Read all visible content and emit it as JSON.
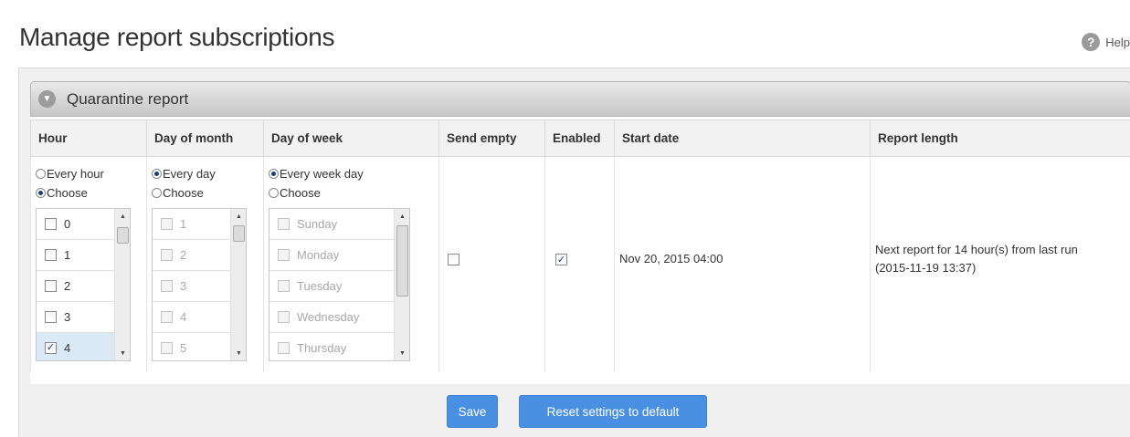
{
  "page": {
    "title": "Manage report subscriptions",
    "help_label": "Help"
  },
  "section": {
    "title": "Quarantine report"
  },
  "columns": [
    "Hour",
    "Day of month",
    "Day of week",
    "Send empty",
    "Enabled",
    "Start date",
    "Report length"
  ],
  "hour": {
    "options": [
      {
        "label": "Every hour",
        "checked": false
      },
      {
        "label": "Choose",
        "checked": true
      }
    ],
    "items": [
      {
        "label": "0",
        "checked": false
      },
      {
        "label": "1",
        "checked": false
      },
      {
        "label": "2",
        "checked": false
      },
      {
        "label": "3",
        "checked": false
      },
      {
        "label": "4",
        "checked": true
      }
    ]
  },
  "day_of_month": {
    "options": [
      {
        "label": "Every day",
        "checked": true
      },
      {
        "label": "Choose",
        "checked": false
      }
    ],
    "items": [
      {
        "label": "1"
      },
      {
        "label": "2"
      },
      {
        "label": "3"
      },
      {
        "label": "4"
      },
      {
        "label": "5"
      }
    ]
  },
  "day_of_week": {
    "options": [
      {
        "label": "Every week day",
        "checked": true
      },
      {
        "label": "Choose",
        "checked": false
      }
    ],
    "items": [
      {
        "label": "Sunday"
      },
      {
        "label": "Monday"
      },
      {
        "label": "Tuesday"
      },
      {
        "label": "Wednesday"
      },
      {
        "label": "Thursday"
      }
    ]
  },
  "send_empty": {
    "checked": false
  },
  "enabled": {
    "checked": true
  },
  "start_date": "Nov 20, 2015 04:00",
  "report_length": {
    "line1": "Next report for 14 hour(s) from last run",
    "line2": "(2015-11-19 13:37)"
  },
  "buttons": {
    "save": "Save",
    "reset": "Reset settings to default"
  },
  "icons": {
    "help": "help-icon",
    "collapse": "chevron-down-icon",
    "check": "checkmark-icon"
  }
}
